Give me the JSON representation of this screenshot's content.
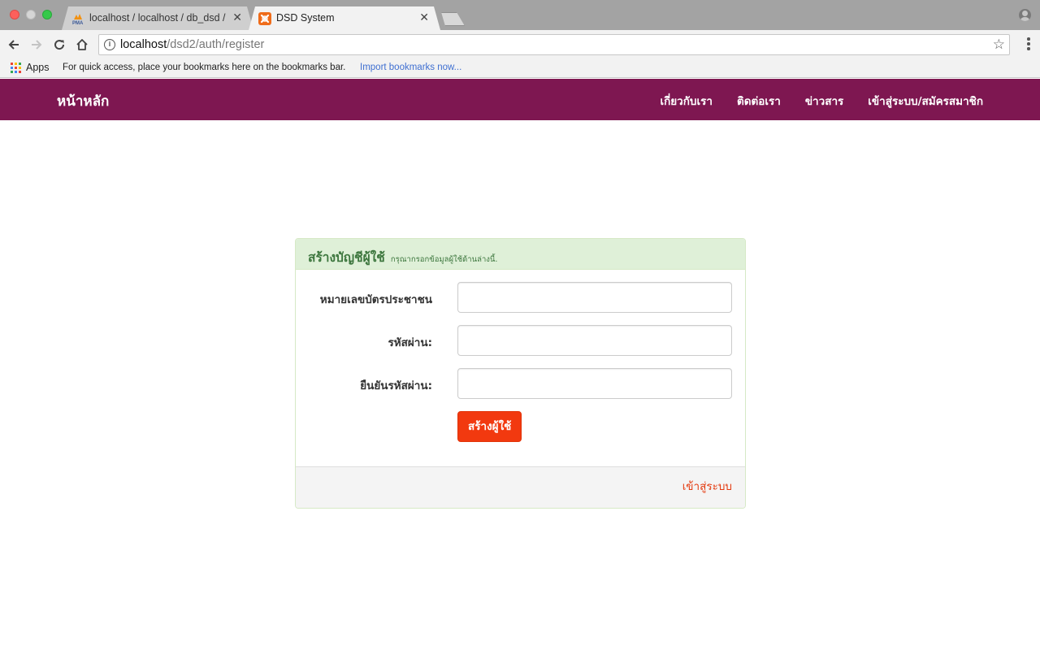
{
  "browser": {
    "tabs": [
      {
        "title": "localhost / localhost / db_dsd / ...",
        "icon": "phpmyadmin-icon",
        "active": false
      },
      {
        "title": "DSD System",
        "icon": "xampp-icon",
        "active": true
      }
    ],
    "close_glyph": "✕",
    "url_host": "localhost",
    "url_path": "/dsd2/auth/register",
    "bookmarks": {
      "apps_label": "Apps",
      "hint": "For quick access, place your bookmarks here on the bookmarks bar.",
      "import_link": "Import bookmarks now..."
    }
  },
  "navbar": {
    "brand": "หน้าหลัก",
    "links": [
      "เกี่ยวกับเรา",
      "ติดต่อเรา",
      "ข่าวสาร",
      "เข้าสู่ระบบ/สมัครสมาชิก"
    ],
    "background": "#7e1751"
  },
  "register_panel": {
    "title": "สร้างบัญชีผู้ใช้",
    "subtitle": "กรุณากรอกข้อมูลผู้ใช้ด้านล่างนี้.",
    "fields": [
      {
        "label": "หมายเลขบัตรประชาชน",
        "value": ""
      },
      {
        "label": "รหัสผ่าน:",
        "value": ""
      },
      {
        "label": "ยืนยันรหัสผ่าน:",
        "value": ""
      }
    ],
    "submit_label": "สร้างผู้ใช้",
    "login_link": "เข้าสู่ระบบ"
  },
  "colors": {
    "accent": "#f2390f",
    "panel_heading": "#dff0d8",
    "panel_title": "#3c763d"
  }
}
